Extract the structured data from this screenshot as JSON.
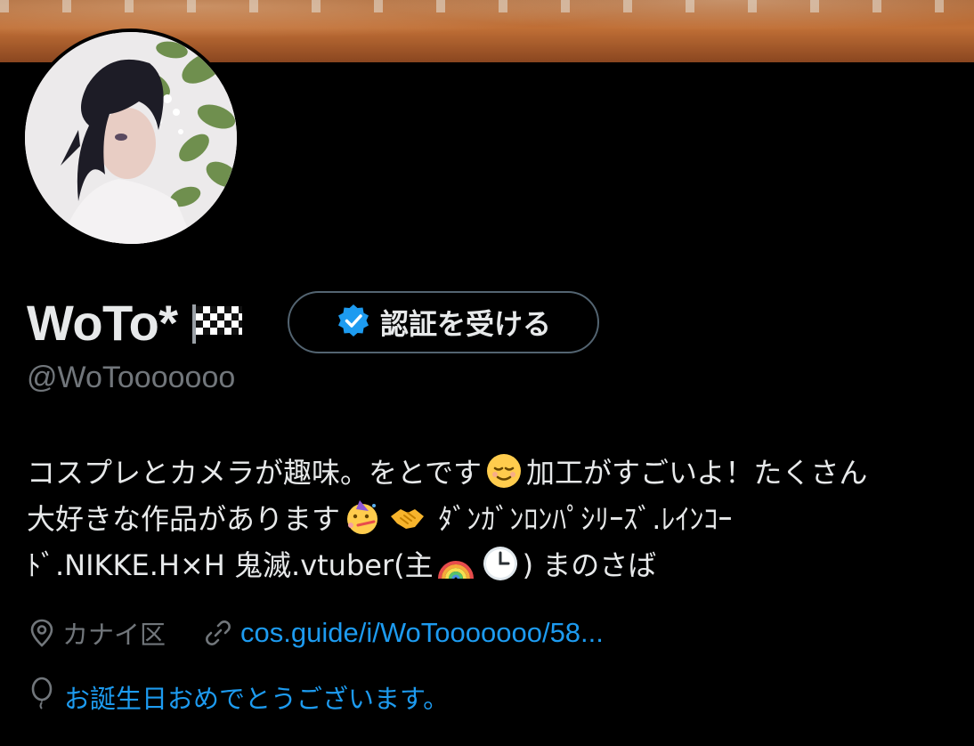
{
  "profile": {
    "display_name": "WoTo*",
    "handle": "@WoTooooooo",
    "verify_button_label": "認証を受ける",
    "bio": {
      "line1_a": "コスプレとカメラが趣味。をとです",
      "line1_b": "加工がすごいよ！たくさん",
      "line2_a": "大好きな作品があります",
      "line2_b": "ﾀﾞﾝｶﾞﾝﾛﾝﾊﾟｼﾘｰｽﾞ.ﾚｲﾝｺｰ",
      "line3_a": "ﾄﾞ.NIKKE.H×H 鬼滅.vtuber(主",
      "line3_b": ") まのさば"
    },
    "location": "カナイ区",
    "link": "cos.guide/i/WoTooooooo/58...",
    "birthday": "お誕生日おめでとうございます。"
  },
  "icons": {
    "flag": "checkered-flag-icon",
    "verified": "verified-badge-icon",
    "location": "location-pin-icon",
    "link": "link-icon",
    "birthday": "balloon-icon",
    "emoji": [
      "relieved-face-emoji",
      "partying-face-emoji",
      "handshake-emoji",
      "rainbow-emoji",
      "clock-emoji"
    ]
  },
  "colors": {
    "background": "#000000",
    "text_primary": "#e7e9ea",
    "text_secondary": "#71767b",
    "link": "#1d9bf0",
    "verified_badge": "#1d9bf0",
    "button_border": "#536471"
  }
}
